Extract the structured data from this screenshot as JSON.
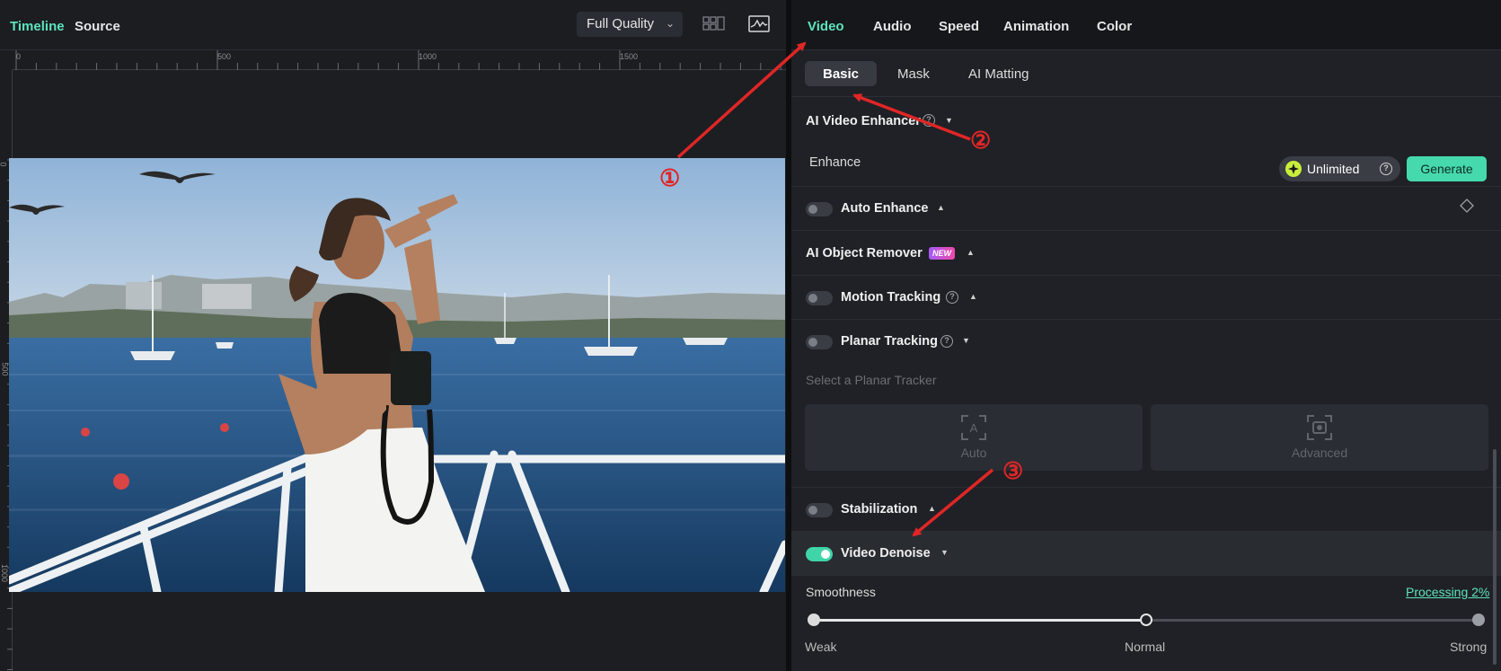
{
  "preview": {
    "tabs": [
      {
        "label": "Timeline",
        "active": true
      },
      {
        "label": "Source",
        "active": false
      }
    ],
    "quality": {
      "selected": "Full Quality"
    },
    "toolbar_icons": [
      "grid-view-icon",
      "waveform-monitor-icon"
    ],
    "ruler_h_labels": [
      "0",
      "500",
      "1000",
      "1500"
    ],
    "ruler_v_labels": [
      "0",
      "500",
      "1000"
    ]
  },
  "panel": {
    "tabs": [
      {
        "label": "Video",
        "active": true
      },
      {
        "label": "Audio",
        "active": false
      },
      {
        "label": "Speed",
        "active": false
      },
      {
        "label": "Animation",
        "active": false
      },
      {
        "label": "Color",
        "active": false
      }
    ],
    "sub_tabs": [
      {
        "label": "Basic",
        "active": true
      },
      {
        "label": "Mask",
        "active": false
      },
      {
        "label": "AI Matting",
        "active": false
      }
    ],
    "ai_enhancer": {
      "title": "AI Video Enhancer",
      "enhance_label": "Enhance",
      "unlimited_label": "Unlimited",
      "generate_label": "Generate"
    },
    "auto_enhance": {
      "title": "Auto Enhance",
      "on": false
    },
    "object_remover": {
      "title": "AI Object Remover",
      "badge": "NEW"
    },
    "motion_tracking": {
      "title": "Motion Tracking",
      "on": false
    },
    "planar_tracking": {
      "title": "Planar Tracking",
      "on": false,
      "select_label": "Select a Planar Tracker",
      "buttons": [
        {
          "label": "Auto",
          "icon": "auto-track-icon"
        },
        {
          "label": "Advanced",
          "icon": "advanced-track-icon"
        }
      ]
    },
    "stabilization": {
      "title": "Stabilization",
      "on": false
    },
    "video_denoise": {
      "title": "Video Denoise",
      "on": true,
      "smoothness_label": "Smoothness",
      "processing_label": "Processing 2%",
      "slider_value": 0.5,
      "levels": [
        "Weak",
        "Normal",
        "Strong"
      ]
    }
  },
  "annotations": [
    "①",
    "②",
    "③"
  ],
  "colors": {
    "accent": "#5ee3be",
    "generate": "#45d9ad",
    "arrow": "#e02626"
  }
}
